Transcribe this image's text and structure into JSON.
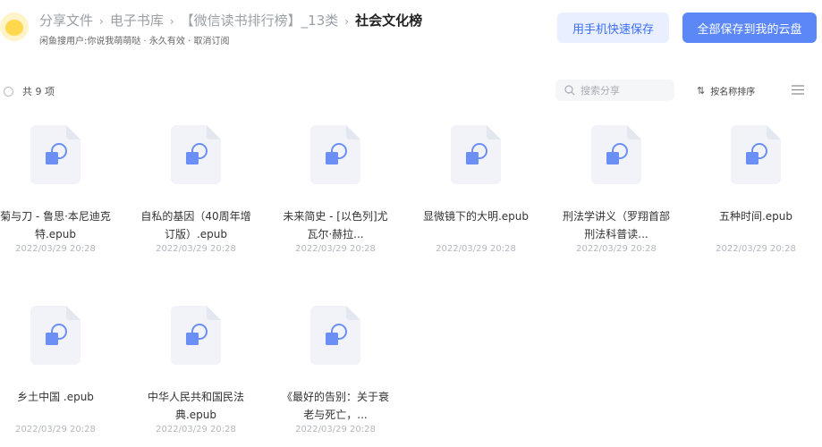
{
  "header": {
    "breadcrumb": [
      "分享文件",
      "电子书库",
      "【微信读书排行榜】_13类",
      "社会文化榜"
    ],
    "subline": "闲鱼搜用户:你说我萌萌哒 · 永久有效 · 取消订阅",
    "phone_save_label": "用手机快速保存",
    "save_all_label": "全部保存到我的云盘"
  },
  "toolbar": {
    "count_label": "共 9 项",
    "search_placeholder": "搜索分享",
    "sort_label": "按名称排序"
  },
  "files": [
    {
      "name": "菊与刀 - 鲁思·本尼迪克特.epub",
      "date": "2022/03/29 20:28"
    },
    {
      "name": "自私的基因（40周年增订版）.epub",
      "date": "2022/03/29 20:28"
    },
    {
      "name": "未来简史 - [以色列]尤瓦尔·赫拉...",
      "date": "2022/03/29 20:28"
    },
    {
      "name": "显微镜下的大明.epub",
      "date": "2022/03/29 20:28"
    },
    {
      "name": "刑法学讲义（罗翔首部刑法科普读...",
      "date": "2022/03/29 20:28"
    },
    {
      "name": "五种时间.epub",
      "date": "2022/03/29 20:28"
    },
    {
      "name": "乡土中国 .epub",
      "date": "2022/03/29 20:28"
    },
    {
      "name": "中华人民共和国民法典.epub",
      "date": "2022/03/29 20:28"
    },
    {
      "name": "《最好的告别：关于衰老与死亡，...",
      "date": "2022/03/29 20:28"
    }
  ],
  "colors": {
    "accent": "#5b87f7",
    "accent_light": "#e9efff",
    "file_icon": "#6b8ff5"
  }
}
